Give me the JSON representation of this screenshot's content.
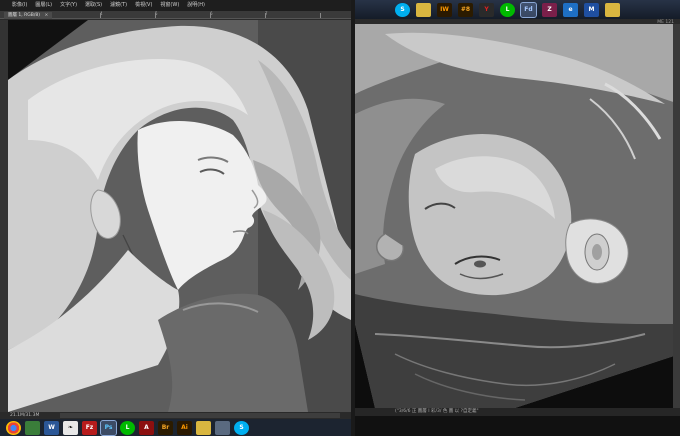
{
  "left_window": {
    "menu": [
      "",
      "影像(I)",
      "圖層(L)",
      "文字(Y)",
      "選取(S)",
      "濾鏡(T)",
      "檢視(V)",
      "視窗(W)",
      "說明(H)"
    ],
    "doc_tab": "圖層 1, RGB/8)",
    "doc_close": "×",
    "ruler_numbers": [
      "",
      "",
      "",
      "",
      "4",
      "5",
      "6",
      "7"
    ],
    "status": "21.1M/31.3M"
  },
  "left_taskbar": {
    "icons": [
      {
        "name": "chrome-icon",
        "text": ""
      },
      {
        "name": "green-app-icon",
        "text": ""
      },
      {
        "name": "word-icon",
        "text": "W"
      },
      {
        "name": "app-icon",
        "text": "❧"
      },
      {
        "name": "filezilla-icon",
        "text": "Fz"
      },
      {
        "name": "photoshop-icon",
        "text": "Ps"
      },
      {
        "name": "line-icon",
        "text": "L"
      },
      {
        "name": "acrobat-icon",
        "text": "A"
      },
      {
        "name": "bridge-icon",
        "text": "Br"
      },
      {
        "name": "illustrator-icon",
        "text": "Ai"
      },
      {
        "name": "folder-icon",
        "text": ""
      },
      {
        "name": "app2-icon",
        "text": ""
      },
      {
        "name": "skype-icon",
        "text": "S"
      }
    ]
  },
  "right_taskbar": {
    "icons": [
      {
        "name": "skype-icon",
        "text": "S"
      },
      {
        "name": "folder-icon",
        "text": ""
      },
      {
        "name": "app-iw-icon",
        "text": "IW"
      },
      {
        "name": "app-8-icon",
        "text": "#8"
      },
      {
        "name": "app-y-icon",
        "text": "Y"
      },
      {
        "name": "line-icon",
        "text": "L"
      },
      {
        "name": "fd-icon",
        "text": "Fd"
      },
      {
        "name": "winrar-icon",
        "text": "Z"
      },
      {
        "name": "ie-icon",
        "text": "e"
      },
      {
        "name": "m-icon",
        "text": "M"
      },
      {
        "name": "folder2-icon",
        "text": ""
      }
    ]
  },
  "right_window": {
    "zoom": "ME 121",
    "status": "(\"3/6/6 正 圖層 I 彩/3/ 色 圖 以 ?自定義\""
  },
  "colors": {
    "taskbar": "#1c2430",
    "menubar": "#1e1e1e",
    "canvas_bg": "#2e2e2e"
  }
}
